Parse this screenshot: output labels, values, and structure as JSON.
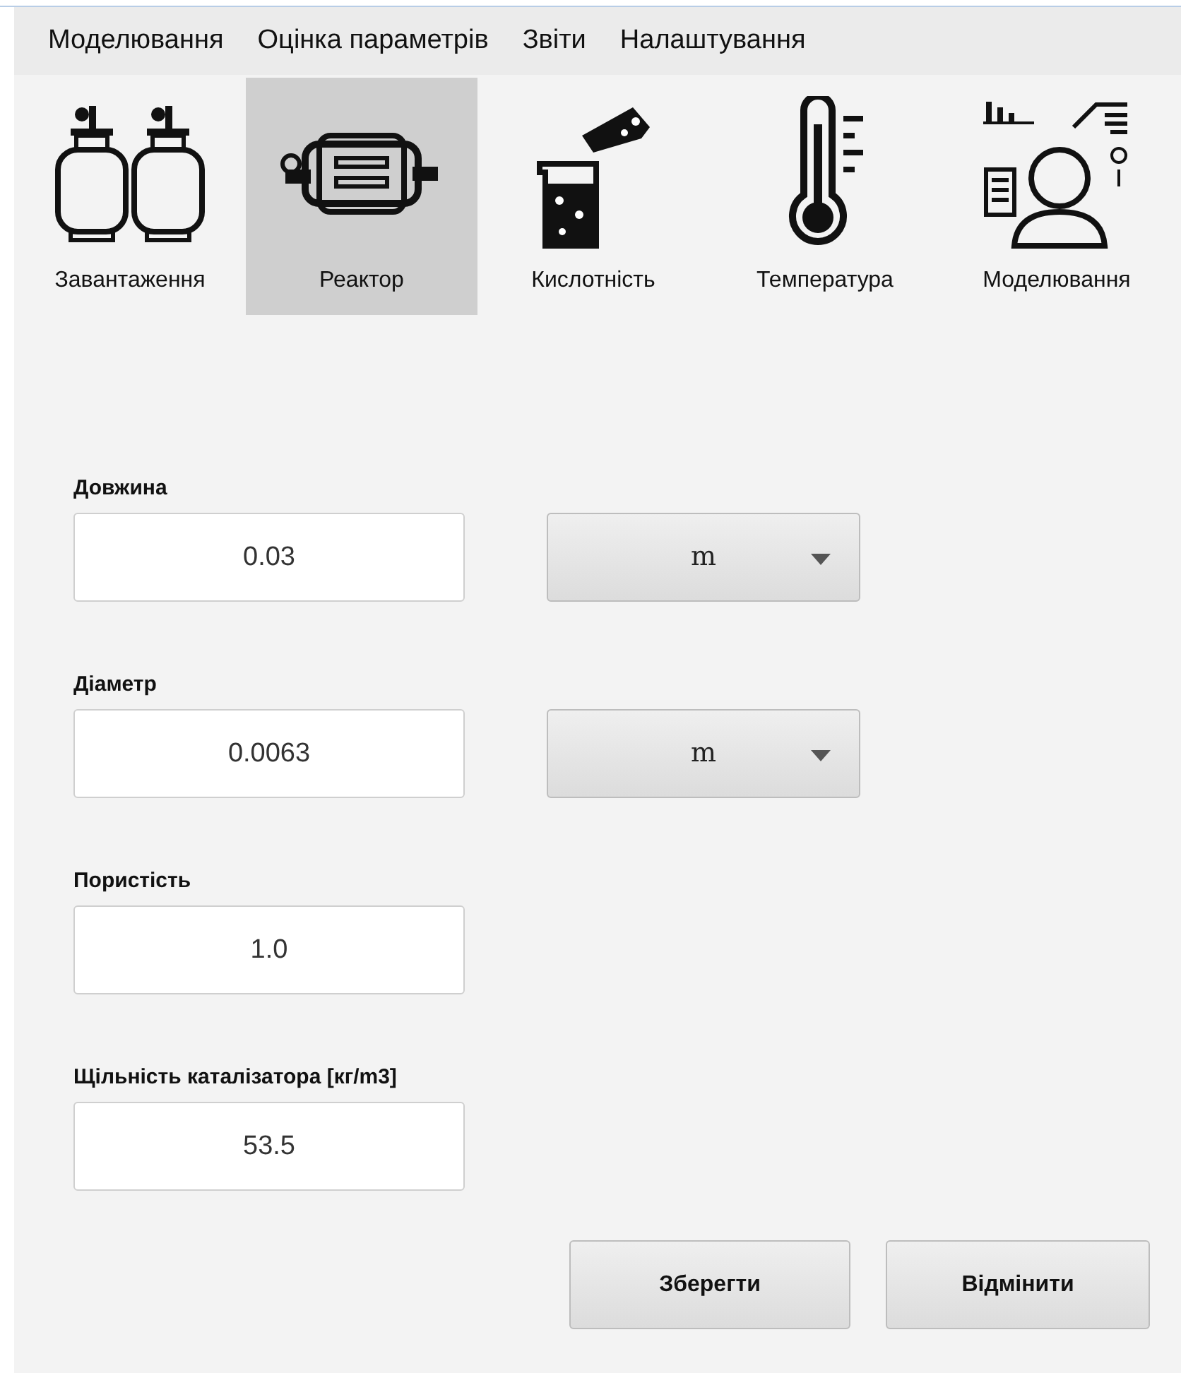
{
  "menu": [
    {
      "label": "Моделювання"
    },
    {
      "label": "Оцінка параметрів"
    },
    {
      "label": "Звіти"
    },
    {
      "label": "Налаштування"
    }
  ],
  "toolbar": [
    {
      "label": "Завантаження",
      "kind": "cylinders",
      "selected": false
    },
    {
      "label": "Реактор",
      "kind": "reactor",
      "selected": true
    },
    {
      "label": "Кислотність",
      "kind": "beaker",
      "selected": false
    },
    {
      "label": "Температура",
      "kind": "thermometer",
      "selected": false
    },
    {
      "label": "Моделювання",
      "kind": "scientist",
      "selected": false
    }
  ],
  "fields": [
    {
      "label": "Довжина",
      "value": "0.03",
      "unit": "m"
    },
    {
      "label": "Діаметр",
      "value": "0.0063",
      "unit": "m"
    },
    {
      "label": "Пористість",
      "value": "1.0"
    },
    {
      "label": "Щільність каталізатора [кг/m3]",
      "value": "53.5"
    }
  ],
  "buttons": [
    {
      "label": "Зберегти"
    },
    {
      "label": "Відмінити"
    }
  ]
}
